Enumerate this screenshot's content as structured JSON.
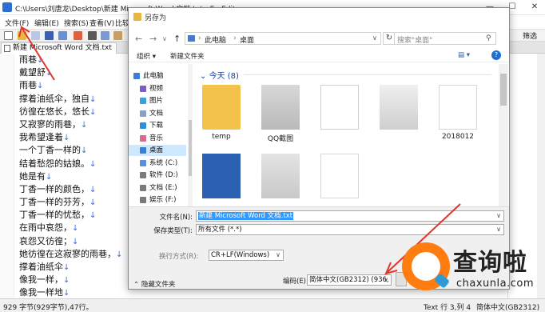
{
  "window": {
    "title": "C:\\Users\\刘唐龙\\Desktop\\新建 Microsoft Word 文档.txt - EmEditor",
    "controls": {
      "minimize": "—",
      "maximize": "☐",
      "close": "✕"
    }
  },
  "menubar": [
    "文件(F)",
    "编辑(E)",
    "搜索(S)",
    "查看(V)",
    "比较"
  ],
  "toolbar": {
    "filter_label": "筛选"
  },
  "doc_tab": {
    "label": "新建 Microsoft Word 文档.txt"
  },
  "editor": {
    "eol_symbol": "↓",
    "lines": [
      "雨巷",
      "戴望舒",
      "雨巷",
      "撑着油纸伞，独自",
      "彷徨在悠长，悠长",
      "又寂寥的雨巷，",
      "我希望逢着",
      "一个丁香一样的",
      "结着愁怨的姑娘。",
      "她是有",
      "丁香一样的颜色，",
      "丁香一样的芬芳，",
      "丁香一样的忧愁，",
      "在雨中哀怨，",
      "哀怨又彷徨；",
      "她彷徨在这寂寥的雨巷，",
      "撑着油纸伞",
      "像我一样，",
      "像我一样地"
    ]
  },
  "statusbar": {
    "left": "929 字节(929字节),47行。",
    "position": "Text 行 3,列 4",
    "encoding": "简体中文(GB2312)"
  },
  "dialog": {
    "title": "另存为",
    "nav": {
      "back": "←",
      "forward": "→",
      "dropdown": "∨",
      "up": "↑"
    },
    "breadcrumb": [
      "此电脑",
      "桌面"
    ],
    "refresh": "↻",
    "search_placeholder": "搜索\"桌面\"",
    "commands": {
      "organize": "组织 ▾",
      "new_folder": "新建文件夹",
      "view": "▤ ▾",
      "help": "?"
    },
    "nav_pane": [
      "此电脑",
      "视频",
      "图片",
      "文档",
      "下载",
      "音乐",
      "桌面",
      "系统 (C:)",
      "软件 (D:)",
      "文档 (E:)",
      "娱乐 (F:)"
    ],
    "nav_selected_index": 6,
    "group_header": "今天 (8)",
    "files": [
      "temp",
      "QQ截图",
      "",
      "",
      "2018012",
      "",
      "",
      ""
    ],
    "form": {
      "filename_label": "文件名(N):",
      "filename_value": "新建 Microsoft Word 文档.txt",
      "filetype_label": "保存类型(T):",
      "filetype_value": "所有文件 (*.*)",
      "linebreak_label": "换行方式(R):",
      "linebreak_value": "CR+LF(Windows)",
      "encoding_label": "编码(E):",
      "encoding_value": "简体中文(GB2312) (936,",
      "hide_folders": "隐藏文件夹"
    }
  },
  "watermark": {
    "title": "查询啦",
    "url": "chaxunla.com"
  },
  "colors": {
    "annotation_arrow": "#e0342c",
    "accent_blue": "#1f6fd1",
    "selection": "#3399ff",
    "watermark_orange": "#ff7d10"
  }
}
